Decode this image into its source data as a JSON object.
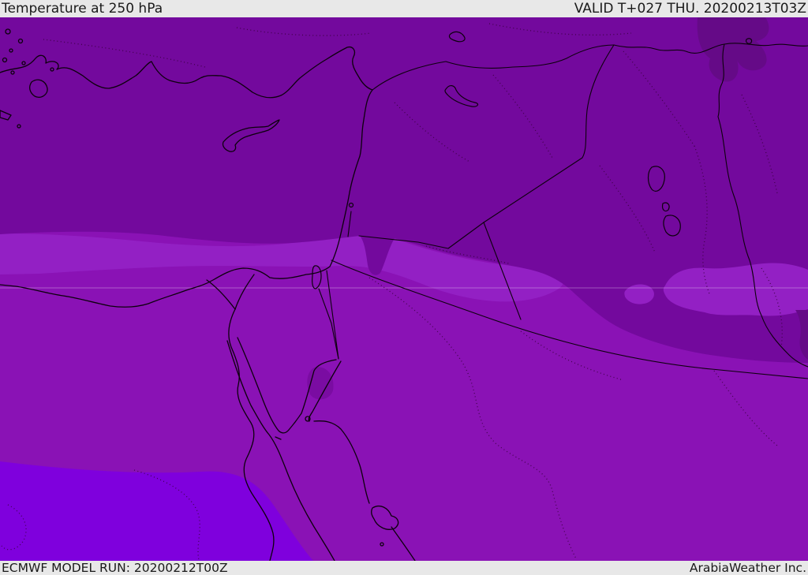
{
  "header": {
    "title": "Temperature at 250 hPa",
    "valid": "VALID T+027 THU. 20200213T03Z"
  },
  "footer": {
    "model_run": "ECMWF MODEL RUN: 20200212T00Z",
    "brand": "ArabiaWeather Inc."
  },
  "map": {
    "palette": {
      "level_darkest": "#650a87",
      "level_dark": "#73099d",
      "level_mid_dark": "#7a0ca2",
      "level_medium": "#8a12b5",
      "level_light": "#9320c4",
      "level_bright": "#7f00dd",
      "border_line": "#0d000d",
      "admin_dots": "#38003d",
      "gridline": "rgba(255,255,255,0.30)",
      "bar_bg": "#e8e8e8",
      "bar_text": "#1a1a1a"
    }
  }
}
